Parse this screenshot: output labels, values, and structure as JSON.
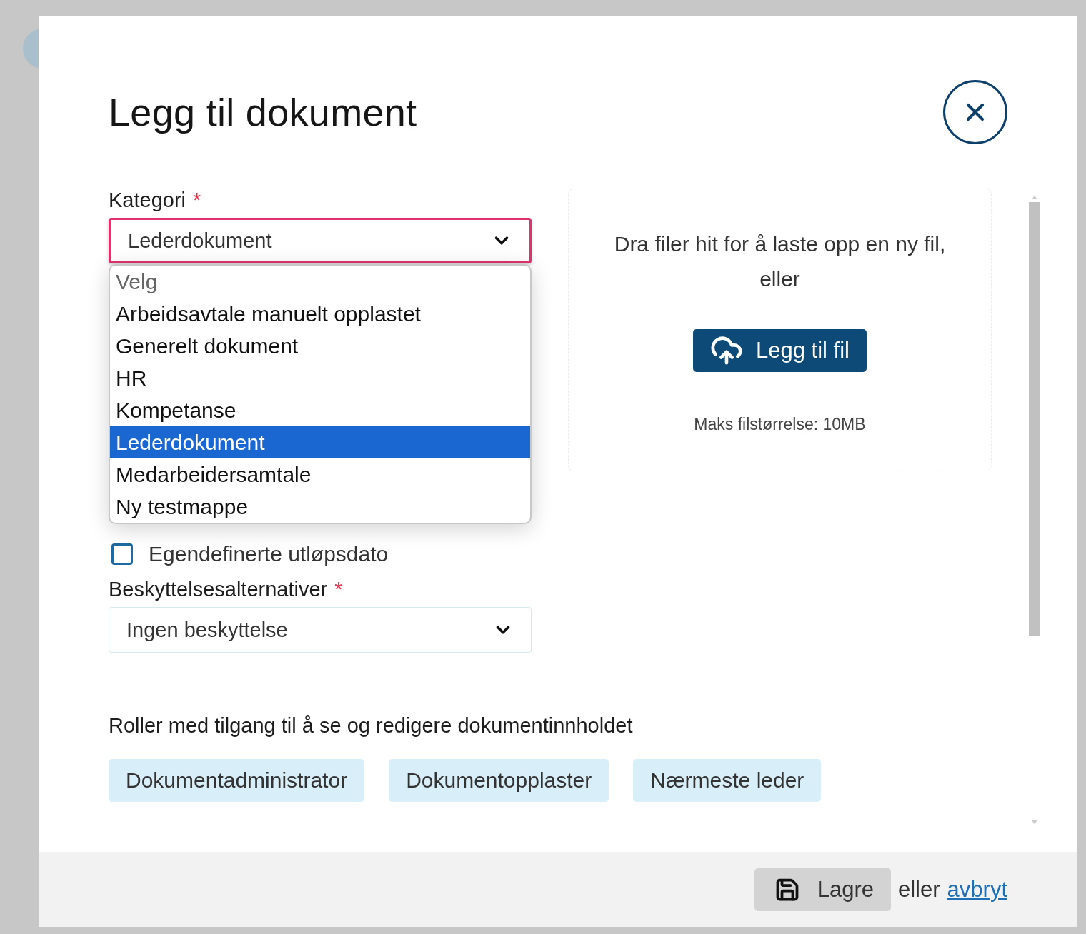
{
  "title": "Legg til dokument",
  "category": {
    "label": "Kategori",
    "required_mark": "*",
    "value": "Lederdokument",
    "focused": true,
    "expanded": true,
    "options": [
      {
        "label": "Velg",
        "disabled": true,
        "selected": false
      },
      {
        "label": "Arbeidsavtale manuelt opplastet",
        "disabled": false,
        "selected": false
      },
      {
        "label": "Generelt dokument",
        "disabled": false,
        "selected": false
      },
      {
        "label": "HR",
        "disabled": false,
        "selected": false
      },
      {
        "label": "Kompetanse",
        "disabled": false,
        "selected": false
      },
      {
        "label": "Lederdokument",
        "disabled": false,
        "selected": true
      },
      {
        "label": "Medarbeidersamtale",
        "disabled": false,
        "selected": false
      },
      {
        "label": "Ny testmappe",
        "disabled": false,
        "selected": false
      }
    ]
  },
  "expiry_checkbox": {
    "label": "Egendefinerte utløpsdato",
    "checked": false
  },
  "protection": {
    "label": "Beskyttelsesalternativer",
    "required_mark": "*",
    "value": "Ingen beskyttelse",
    "focused": false
  },
  "upload": {
    "prompt": "Dra filer hit for å laste opp en ny fil, eller",
    "button": "Legg til fil",
    "max_size": "Maks filstørrelse: 10MB"
  },
  "roles": {
    "heading": "Roller med tilgang til å se og redigere dokumentinnholdet",
    "items": [
      "Dokumentadministrator",
      "Dokumentopplaster",
      "Nærmeste leder"
    ]
  },
  "footer": {
    "save": "Lagre",
    "separator": "eller",
    "cancel": "avbryt"
  }
}
